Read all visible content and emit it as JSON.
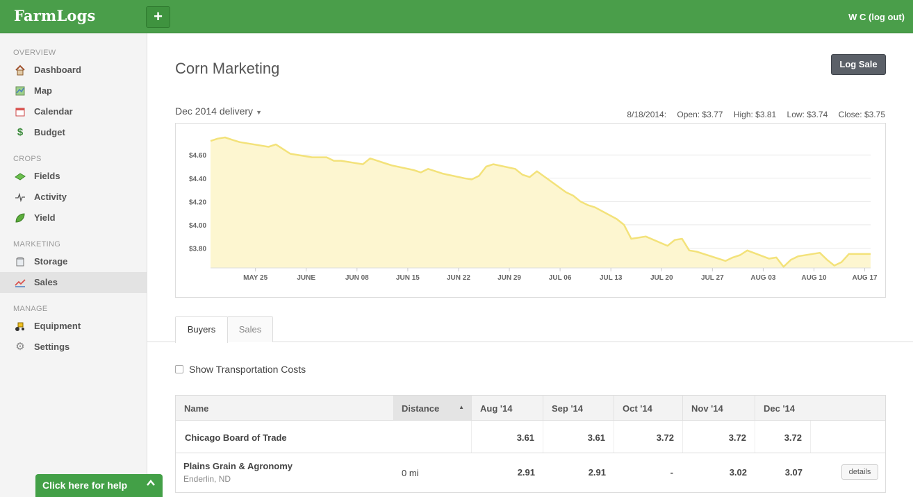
{
  "app": {
    "logo": "FarmLogs",
    "plus": "+",
    "user": "W C (log out)"
  },
  "sidebar": {
    "sections": [
      {
        "heading": "OVERVIEW",
        "items": [
          {
            "label": "Dashboard",
            "icon": "house-icon"
          },
          {
            "label": "Map",
            "icon": "map-icon"
          },
          {
            "label": "Calendar",
            "icon": "calendar-icon"
          },
          {
            "label": "Budget",
            "icon": "dollar-icon"
          }
        ]
      },
      {
        "heading": "CROPS",
        "items": [
          {
            "label": "Fields",
            "icon": "fields-icon"
          },
          {
            "label": "Activity",
            "icon": "activity-icon"
          },
          {
            "label": "Yield",
            "icon": "leaf-icon"
          }
        ]
      },
      {
        "heading": "MARKETING",
        "items": [
          {
            "label": "Storage",
            "icon": "storage-bin-icon"
          },
          {
            "label": "Sales",
            "icon": "sales-chart-icon",
            "active": true
          }
        ]
      },
      {
        "heading": "MANAGE",
        "items": [
          {
            "label": "Equipment",
            "icon": "tractor-icon"
          },
          {
            "label": "Settings",
            "icon": "gear-icon"
          }
        ]
      }
    ]
  },
  "help": {
    "label": "Click here for help",
    "chevron": "^"
  },
  "page": {
    "title": "Corn Marketing",
    "log_sale": "Log Sale",
    "delivery": "Dec 2014 delivery",
    "quote": {
      "date": "8/18/2014:",
      "open": "Open: $3.77",
      "high": "High: $3.81",
      "low": "Low: $3.74",
      "close": "Close: $3.75"
    }
  },
  "chart_data": {
    "type": "area",
    "color": "#f3e27a",
    "fill": "#fdf6d0",
    "y_ticks": [
      "$4.60",
      "$4.40",
      "$4.20",
      "$4.00",
      "$3.80"
    ],
    "x_ticks": [
      "MAY 25",
      "JUNE",
      "JUN 08",
      "JUN 15",
      "JUN 22",
      "JUN 29",
      "JUL 06",
      "JUL 13",
      "JUL 20",
      "JUL 27",
      "AUG 03",
      "AUG 10",
      "AUG 17"
    ],
    "ylim": [
      3.63,
      4.78
    ],
    "x": [
      "May 19",
      "May 20",
      "May 21",
      "May 22",
      "May 23",
      "May 27",
      "May 28",
      "May 29",
      "May 30",
      "Jun 2",
      "Jun 3",
      "Jun 4",
      "Jun 5",
      "Jun 6",
      "Jun 9",
      "Jun 10",
      "Jun 11",
      "Jun 12",
      "Jun 13",
      "Jun 16",
      "Jun 17",
      "Jun 18",
      "Jun 19",
      "Jun 20",
      "Jun 23",
      "Jun 24",
      "Jun 25",
      "Jun 26",
      "Jun 27",
      "Jun 30",
      "Jul 1",
      "Jul 2",
      "Jul 3",
      "Jul 7",
      "Jul 8",
      "Jul 9",
      "Jul 10",
      "Jul 11",
      "Jul 14",
      "Jul 15",
      "Jul 16",
      "Jul 17",
      "Jul 18",
      "Jul 21",
      "Jul 22",
      "Jul 23",
      "Jul 24",
      "Jul 25",
      "Jul 28",
      "Jul 29",
      "Jul 30",
      "Jul 31",
      "Aug 1",
      "Aug 4",
      "Aug 5",
      "Aug 6",
      "Aug 7",
      "Aug 8",
      "Aug 11",
      "Aug 12",
      "Aug 13",
      "Aug 14",
      "Aug 15",
      "Aug 18"
    ],
    "values": [
      4.72,
      4.74,
      4.75,
      4.73,
      4.71,
      4.67,
      4.69,
      4.65,
      4.61,
      4.58,
      4.58,
      4.58,
      4.55,
      4.55,
      4.52,
      4.57,
      4.55,
      4.53,
      4.51,
      4.47,
      4.45,
      4.48,
      4.46,
      4.44,
      4.4,
      4.39,
      4.42,
      4.5,
      4.52,
      4.48,
      4.43,
      4.41,
      4.46,
      4.28,
      4.25,
      4.2,
      4.17,
      4.15,
      4.05,
      4.0,
      3.88,
      3.89,
      3.9,
      3.82,
      3.87,
      3.88,
      3.78,
      3.77,
      3.71,
      3.69,
      3.72,
      3.74,
      3.78,
      3.71,
      3.72,
      3.64,
      3.7,
      3.73,
      3.76,
      3.7,
      3.65,
      3.68,
      3.75,
      3.75
    ]
  },
  "tabs": [
    {
      "label": "Buyers",
      "active": true
    },
    {
      "label": "Sales",
      "active": false
    }
  ],
  "checkbox": {
    "label": "Show Transportation Costs",
    "checked": false
  },
  "table": {
    "headers": [
      "Name",
      "Distance",
      "Aug '14",
      "Sep '14",
      "Oct '14",
      "Nov '14",
      "Dec '14"
    ],
    "cbot": {
      "name": "Chicago Board of Trade",
      "distance": "",
      "values": [
        "3.61",
        "3.61",
        "3.72",
        "3.72",
        "3.72"
      ]
    },
    "rows": [
      {
        "name": "Plains Grain & Agronomy",
        "location": "Enderlin, ND",
        "distance": "0 mi",
        "values": [
          "2.91",
          "2.91",
          "-",
          "3.02",
          "3.07"
        ],
        "action": "details"
      }
    ]
  }
}
